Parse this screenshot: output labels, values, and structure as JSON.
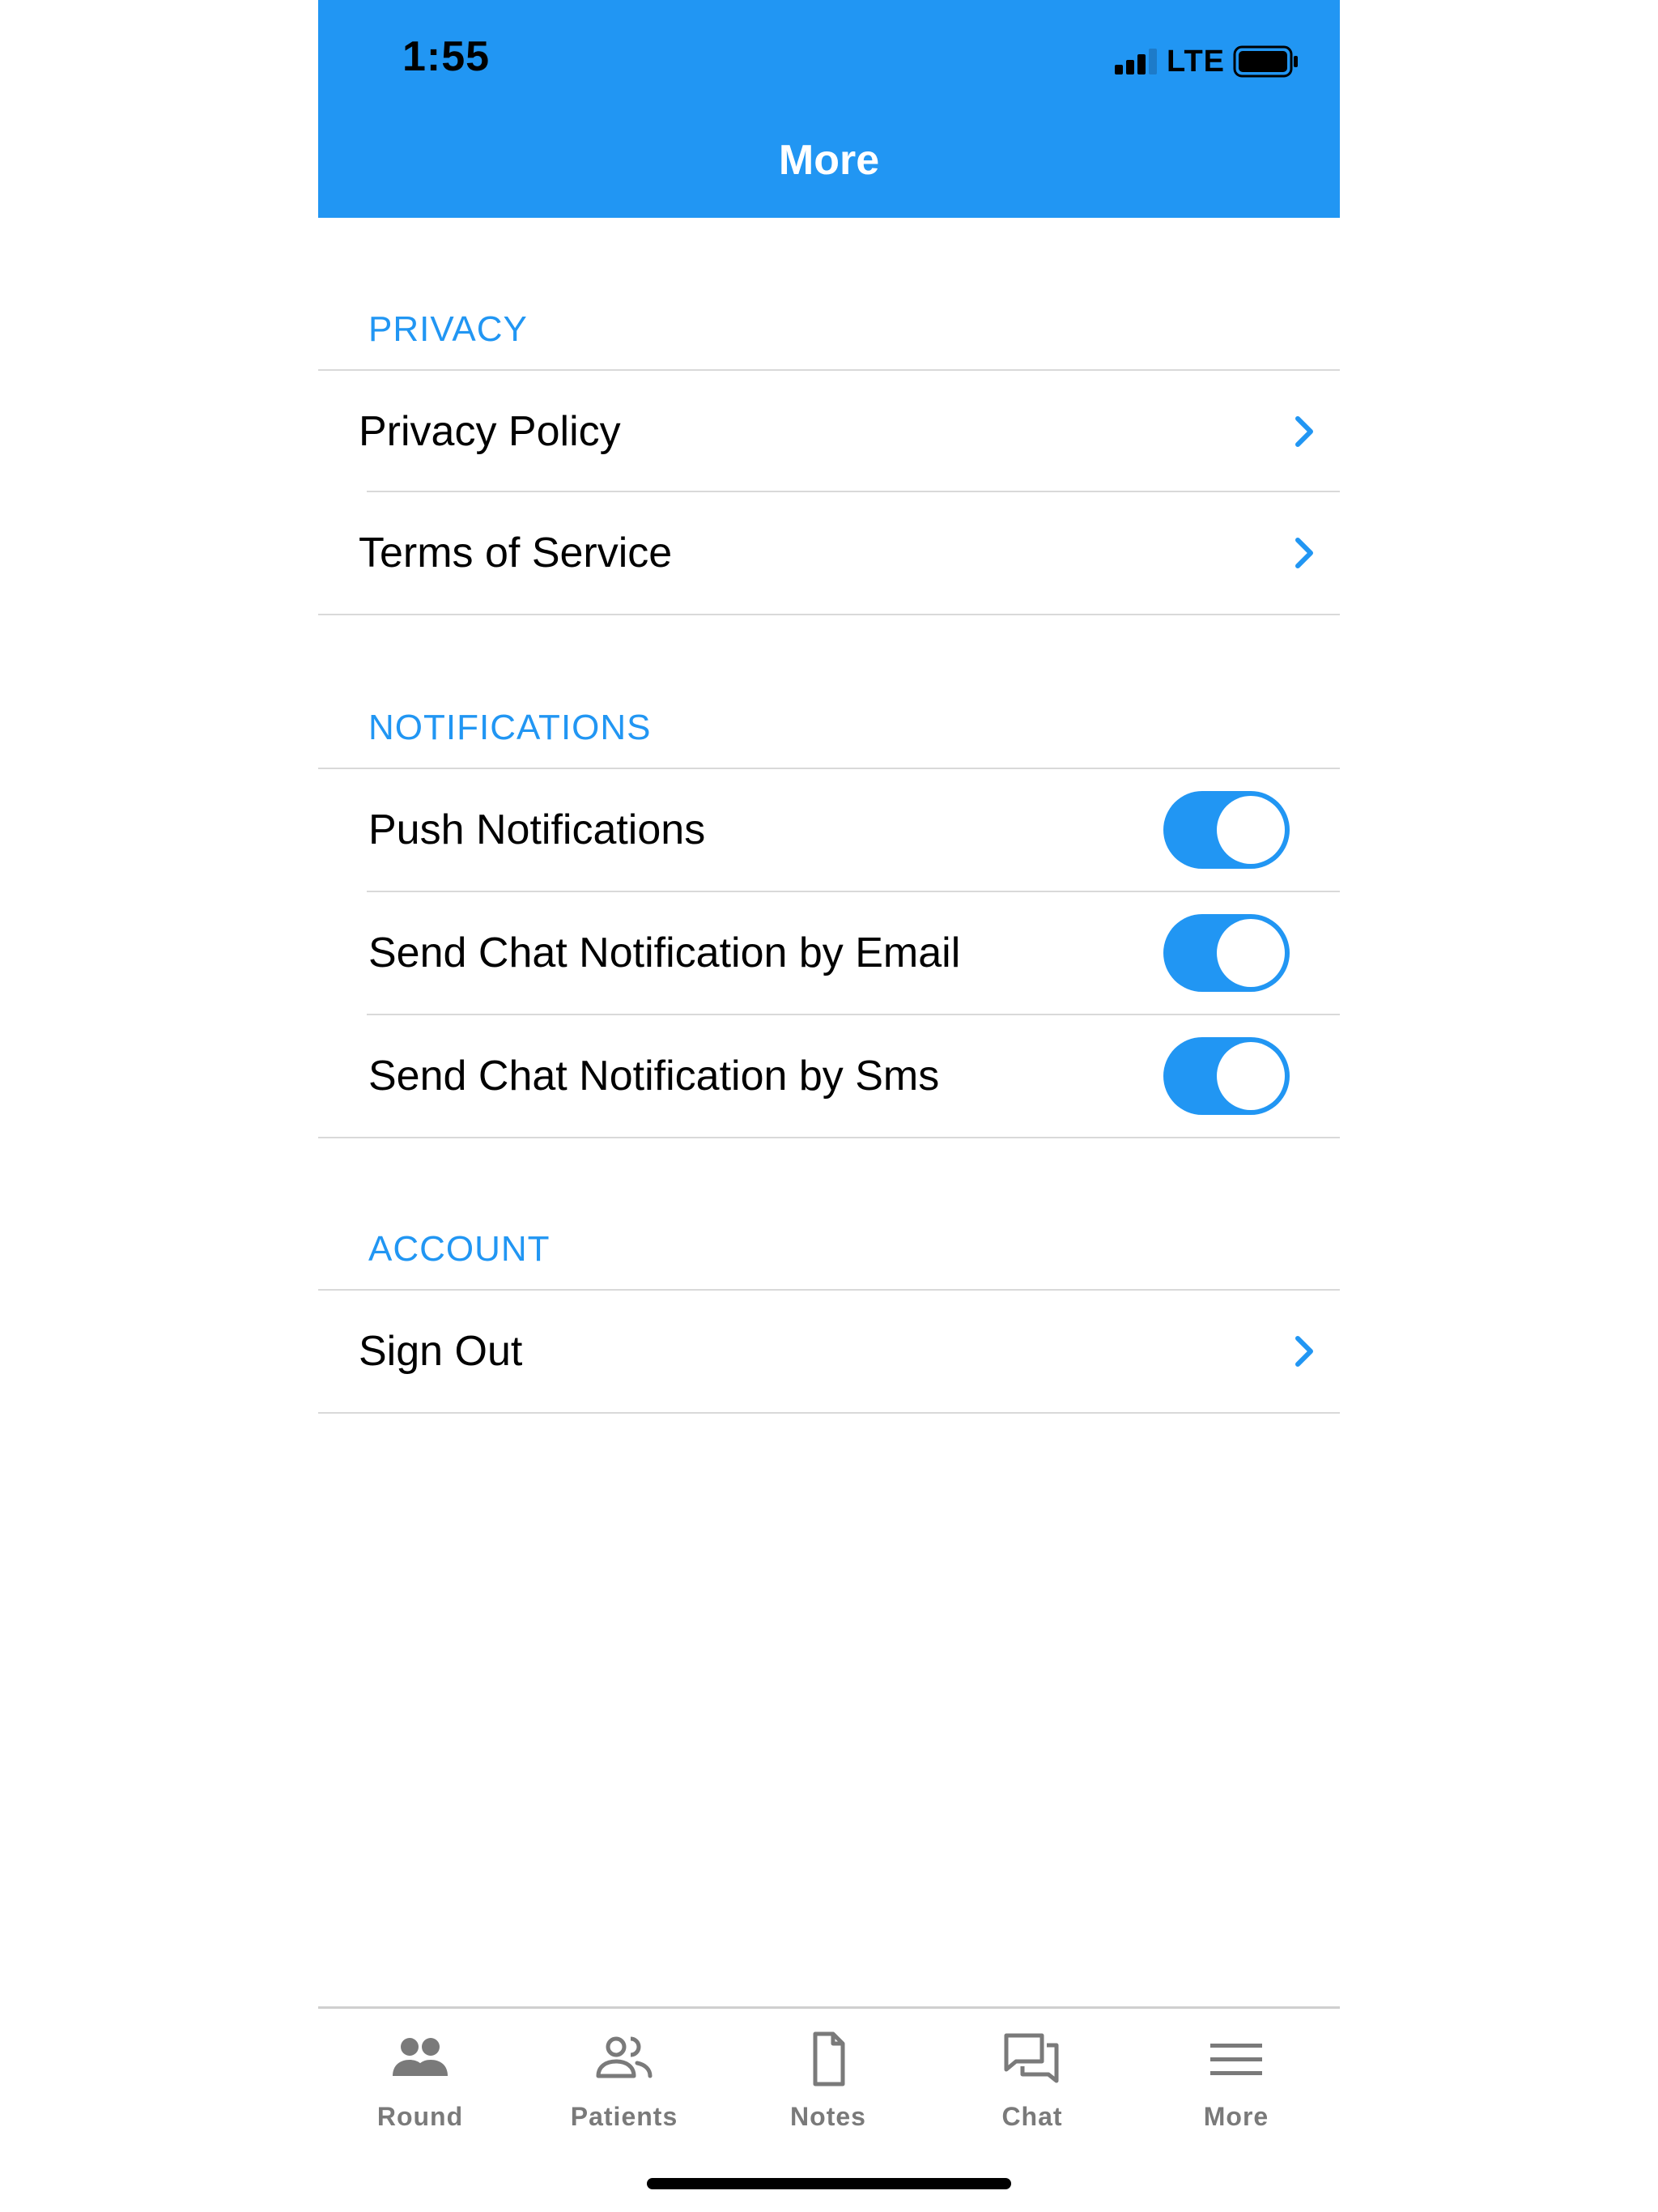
{
  "status_bar": {
    "time": "1:55",
    "network": "LTE"
  },
  "header": {
    "title": "More",
    "background_color": "#2196F3"
  },
  "sections": {
    "privacy": {
      "title": "PRIVACY",
      "items": [
        {
          "label": "Privacy Policy",
          "icon": "chevron-right-icon"
        },
        {
          "label": "Terms of Service",
          "icon": "chevron-right-icon"
        }
      ]
    },
    "notifications": {
      "title": "NOTIFICATIONS",
      "items": [
        {
          "label": "Push Notifications",
          "enabled": true
        },
        {
          "label": "Send Chat Notification by Email",
          "enabled": true
        },
        {
          "label": "Send Chat Notification by Sms",
          "enabled": true
        }
      ]
    },
    "account": {
      "title": "ACCOUNT",
      "items": [
        {
          "label": "Sign Out",
          "icon": "chevron-right-icon"
        }
      ]
    }
  },
  "tabbar": {
    "tabs": [
      {
        "label": "Round",
        "icon": "group-filled-icon"
      },
      {
        "label": "Patients",
        "icon": "group-outline-icon"
      },
      {
        "label": "Notes",
        "icon": "document-icon"
      },
      {
        "label": "Chat",
        "icon": "chat-bubbles-icon"
      },
      {
        "label": "More",
        "icon": "menu-icon"
      }
    ],
    "active": "More"
  },
  "colors": {
    "accent": "#2196F3",
    "tab_inactive": "#7a7a7a",
    "divider": "#d9d9d9"
  }
}
